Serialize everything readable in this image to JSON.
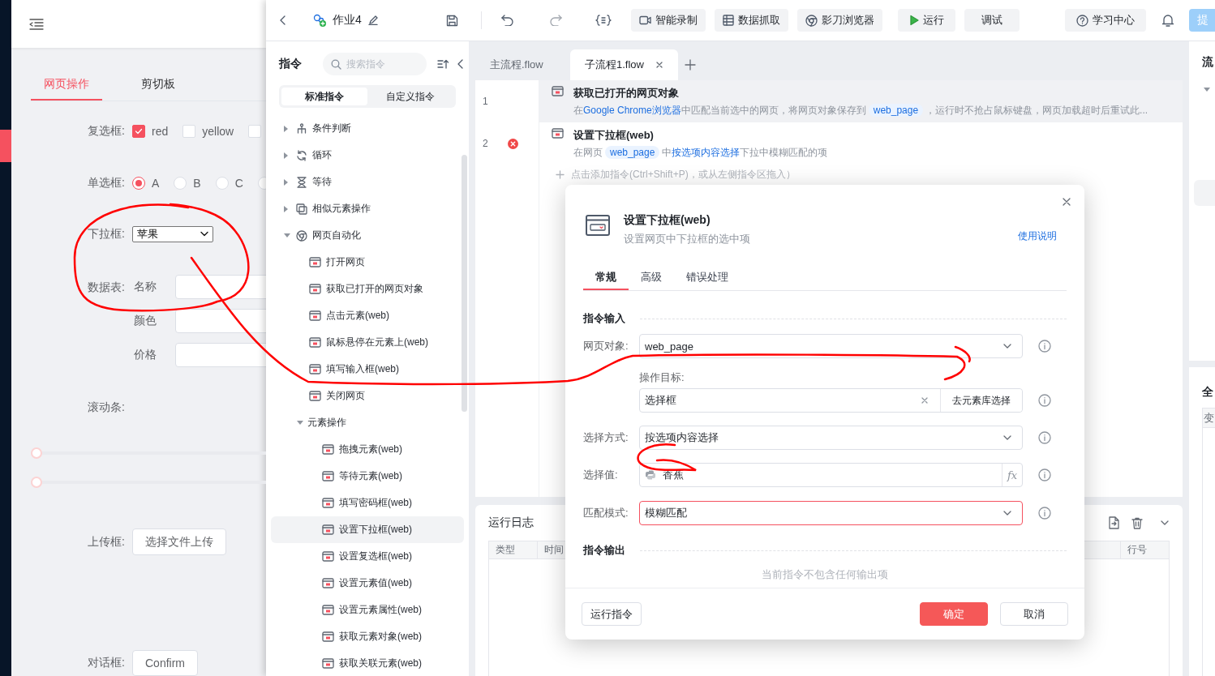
{
  "background_app": {
    "tabs": [
      {
        "label": "网页操作",
        "selected": true
      },
      {
        "label": "剪切板",
        "selected": false
      }
    ],
    "checkboxes": {
      "label": "复选框:",
      "options": [
        {
          "label": "red",
          "checked": true
        },
        {
          "label": "yellow",
          "checked": false
        },
        {
          "checked": false
        }
      ]
    },
    "radios": {
      "label": "单选框:",
      "options": [
        {
          "label": "A",
          "selected": true
        },
        {
          "label": "B",
          "selected": false
        },
        {
          "label": "C",
          "selected": false
        },
        {
          "selected": false
        }
      ]
    },
    "dropdown": {
      "label": "下拉框:",
      "value": "苹果"
    },
    "data_table": {
      "label": "数据表:",
      "fields": [
        "名称",
        "颜色",
        "价格"
      ]
    },
    "scrollbars": {
      "label": "滚动条:",
      "sliders": [
        {
          "level": 0
        },
        {
          "level": 0
        }
      ]
    },
    "upload": {
      "label": "上传框:",
      "button": "选择文件上传"
    },
    "dialog": {
      "label": "对话框:",
      "button": "Confirm"
    }
  },
  "toolbar": {
    "project": "作业4",
    "tools": [
      {
        "label": "智能录制",
        "kind": "record"
      },
      {
        "label": "数据抓取",
        "kind": "table"
      },
      {
        "label": "影刀浏览器",
        "kind": "browser"
      }
    ],
    "run": "运行",
    "debug": "调试",
    "learn": "学习中心",
    "publish": "提"
  },
  "command_panel": {
    "title": "指令",
    "search": {
      "placeholder": "搜索指令"
    },
    "segments": [
      {
        "label": "标准指令",
        "selected": true
      },
      {
        "label": "自定义指令",
        "selected": false
      }
    ],
    "tree": [
      {
        "label": "条件判断",
        "kind": "branch",
        "expanded": false
      },
      {
        "label": "循环",
        "kind": "loop",
        "expanded": false
      },
      {
        "label": "等待",
        "kind": "wait",
        "expanded": false
      },
      {
        "label": "相似元素操作",
        "kind": "similar",
        "expanded": false
      },
      {
        "label": "网页自动化",
        "kind": "browser",
        "expanded": true,
        "children": [
          {
            "label": "打开网页",
            "selected": false
          },
          {
            "label": "获取已打开的网页对象",
            "selected": false
          },
          {
            "label": "点击元素(web)",
            "selected": false
          },
          {
            "label": "鼠标悬停在元素上(web)",
            "selected": false
          },
          {
            "label": "填写输入框(web)",
            "selected": false
          },
          {
            "label": "关闭网页",
            "selected": false
          },
          {
            "label": "元素操作",
            "expanded": true,
            "children": [
              {
                "label": "拖拽元素(web)",
                "selected": false
              },
              {
                "label": "等待元素(web)",
                "selected": false
              },
              {
                "label": "填写密码框(web)",
                "selected": false
              },
              {
                "label": "设置下拉框(web)",
                "selected": true
              },
              {
                "label": "设置复选框(web)",
                "selected": false
              },
              {
                "label": "设置元素值(web)",
                "selected": false
              },
              {
                "label": "设置元素属性(web)",
                "selected": false
              },
              {
                "label": "获取元素对象(web)",
                "selected": false
              },
              {
                "label": "获取关联元素(web)",
                "selected": false
              }
            ]
          }
        ]
      }
    ]
  },
  "editor": {
    "tabs": [
      {
        "label": "主流程.flow",
        "selected": false
      },
      {
        "label": "子流程1.flow",
        "selected": true
      }
    ],
    "steps": [
      {
        "number": "1",
        "title": "获取已打开的网页对象",
        "selected": true,
        "error": false,
        "description": [
          {
            "kind": "plain",
            "text": "在"
          },
          {
            "kind": "link",
            "text": "Google Chrome浏览器"
          },
          {
            "kind": "plain",
            "text": "中匹配当前选中的网页，将网页对象保存到"
          },
          {
            "kind": "chip",
            "text": "web_page"
          },
          {
            "kind": "plain",
            "text": "，运行时不抢占鼠标键盘，网页加载超时后重试此..."
          }
        ]
      },
      {
        "number": "2",
        "title": "设置下拉框(web)",
        "selected": false,
        "error": true,
        "description": [
          {
            "kind": "plain",
            "text": "在网页"
          },
          {
            "kind": "chip",
            "text": "web_page"
          },
          {
            "kind": "plain",
            "text": "中"
          },
          {
            "kind": "link",
            "text": "按选项内容选择"
          },
          {
            "kind": "plain",
            "text": "下拉中模糊匹配的项"
          }
        ]
      }
    ],
    "add_hint": "点击添加指令(Ctrl+Shift+P)，或从左侧指令区拖入）"
  },
  "run_log": {
    "title": "运行日志",
    "columns": [
      "类型",
      "时间",
      "行号"
    ]
  },
  "side_panel": {
    "flow_title": "流",
    "global_title": "全",
    "global_columns": [
      "变"
    ]
  },
  "dialog": {
    "title": "设置下拉框(web)",
    "subtitle": "设置网页中下拉框的选中项",
    "help_link": "使用说明",
    "tabs": [
      {
        "label": "常规",
        "selected": true
      },
      {
        "label": "高级",
        "selected": false
      },
      {
        "label": "错误处理",
        "selected": false
      }
    ],
    "input_section": "指令输入",
    "fields": [
      {
        "kind": "select",
        "label": "网页对象:",
        "value": "web_page",
        "highlighted": false
      },
      {
        "kind": "target",
        "label": "操作目标:",
        "value": "选择框",
        "button": "去元素库选择"
      },
      {
        "kind": "select",
        "label": "选择方式:",
        "value": "按选项内容选择",
        "highlighted": false
      },
      {
        "kind": "expression",
        "label": "选择值:",
        "value": "香蕉",
        "button": "fx"
      },
      {
        "kind": "select",
        "label": "匹配模式:",
        "value": "模糊匹配",
        "highlighted": true
      }
    ],
    "output_section": "指令输出",
    "output_empty": "当前指令不包含任何输出项",
    "run_button": "运行指令",
    "ok_button": "确定",
    "cancel_button": "取消"
  }
}
